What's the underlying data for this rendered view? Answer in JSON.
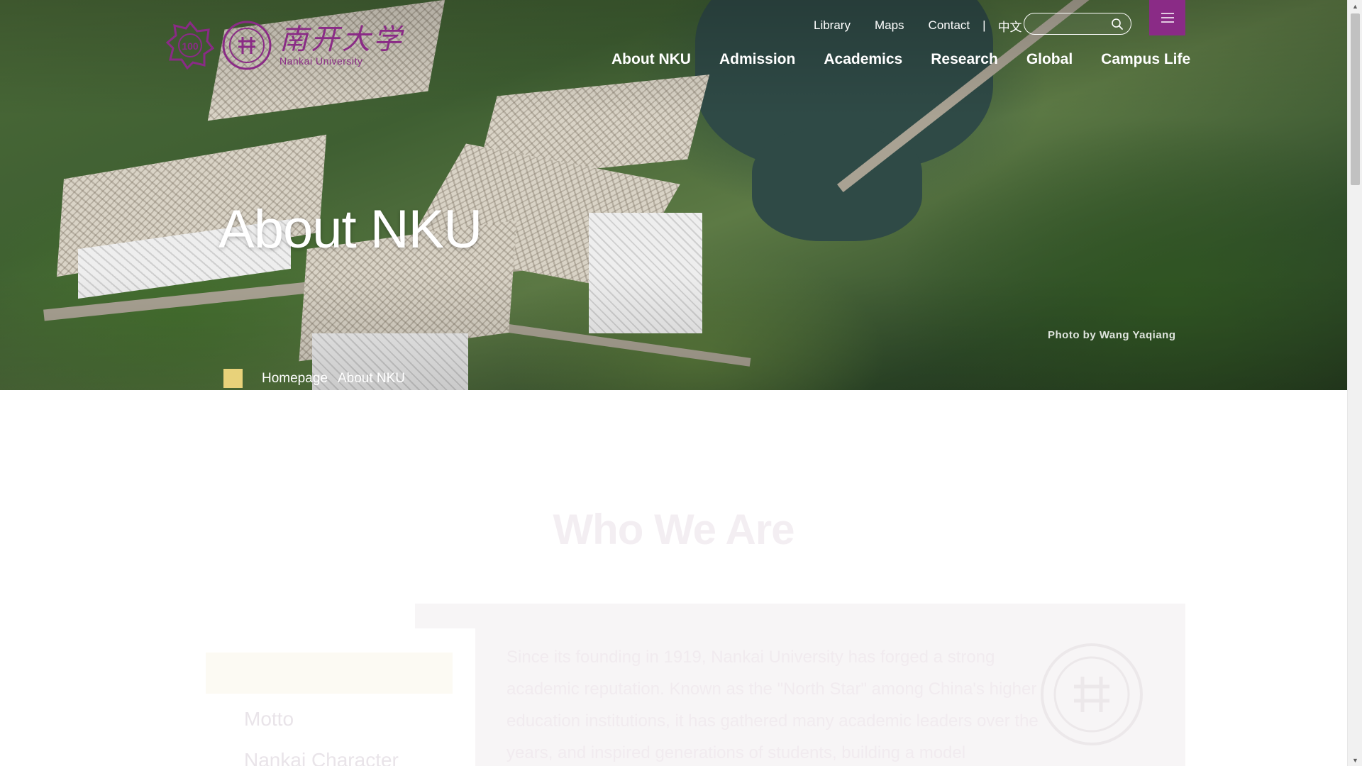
{
  "header": {
    "top_links": [
      "Library",
      "Maps",
      "Contact"
    ],
    "separator": "|",
    "language": "中文",
    "search": {
      "placeholder": ""
    },
    "menu_icon": "hamburger-menu-icon",
    "logo": {
      "cn": "南开大学",
      "en": "Nankai University",
      "badge": "100"
    },
    "nav": [
      "About NKU",
      "Admission",
      "Academics",
      "Research",
      "Global",
      "Campus Life"
    ]
  },
  "hero": {
    "title": "About NKU",
    "photo_credit": "Photo by Wang Yaqiang",
    "breadcrumb": [
      "Homepage",
      "About NKU"
    ],
    "breadcrumb_separator": ">"
  },
  "section": {
    "title": "Who We Are",
    "side_menu": [
      "",
      "Motto",
      "Nankai Character"
    ],
    "intro": "Since its founding in 1919, Nankai University has forged a strong academic reputation. Known as the \"North Star\" among China's higher education institutions, it has gathered many academic leaders over the years, and inspired generations of students, building a model"
  },
  "colors": {
    "brand_purple": "#8a2b86",
    "breadcrumb_home": "#e8d27a"
  }
}
